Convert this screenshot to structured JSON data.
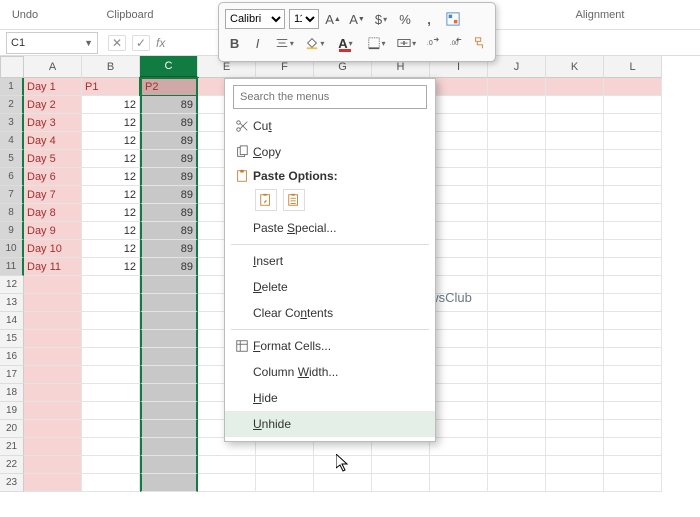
{
  "ribbon": {
    "undo": "Undo",
    "clipboard": "Clipboard",
    "alignment": "Alignment"
  },
  "mini_toolbar": {
    "font_name": "Calibri",
    "font_size": "11",
    "bold": "B",
    "italic": "I"
  },
  "formula_bar": {
    "name_box": "C1",
    "cancel": "✕",
    "confirm": "✓",
    "fx": "fx"
  },
  "columns": [
    "A",
    "B",
    "C",
    "E",
    "F",
    "G",
    "H",
    "I",
    "J",
    "K",
    "L"
  ],
  "selected_column_index": 2,
  "rows_visible": 23,
  "data_rows": [
    {
      "a": "Day 1",
      "b": "P1",
      "c": "P2"
    },
    {
      "a": "Day 2",
      "b": "12",
      "c": "89"
    },
    {
      "a": "Day 3",
      "b": "12",
      "c": "89"
    },
    {
      "a": "Day 4",
      "b": "12",
      "c": "89"
    },
    {
      "a": "Day 5",
      "b": "12",
      "c": "89"
    },
    {
      "a": "Day 6",
      "b": "12",
      "c": "89"
    },
    {
      "a": "Day 7",
      "b": "12",
      "c": "89"
    },
    {
      "a": "Day 8",
      "b": "12",
      "c": "89"
    },
    {
      "a": "Day 9",
      "b": "12",
      "c": "89"
    },
    {
      "a": "Day 10",
      "b": "12",
      "c": "89"
    },
    {
      "a": "Day 11",
      "b": "12",
      "c": "89"
    }
  ],
  "context_menu": {
    "search_placeholder": "Search the menus",
    "cut": "Cut",
    "copy": "Copy",
    "paste_options": "Paste Options:",
    "paste_special": "Paste Special...",
    "insert": "Insert",
    "delete": "Delete",
    "clear_contents": "Clear Contents",
    "format_cells": "Format Cells...",
    "column_width": "Column Width...",
    "hide": "Hide",
    "unhide": "Unhide"
  },
  "watermark": "TheWindowsClub"
}
